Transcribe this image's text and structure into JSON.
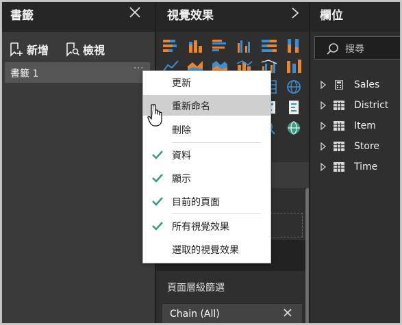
{
  "bookmarks_pane": {
    "title": "書籤",
    "add_label": "新增",
    "view_label": "檢視",
    "items": [
      {
        "label": "書籤 1",
        "more": "···"
      }
    ]
  },
  "visualizations_pane": {
    "title": "視覺效果",
    "page_filters_label": "頁面層級篩選",
    "filter_chip": {
      "label": "Chain (All)"
    }
  },
  "fields_pane": {
    "title": "欄位",
    "search_placeholder": "搜尋",
    "fields": [
      {
        "name": "Sales",
        "icon": "calculator-icon"
      },
      {
        "name": "District",
        "icon": "table-icon"
      },
      {
        "name": "Item",
        "icon": "table-icon"
      },
      {
        "name": "Store",
        "icon": "table-icon"
      },
      {
        "name": "Time",
        "icon": "table-icon"
      }
    ]
  },
  "context_menu": {
    "items": [
      {
        "label": "更新",
        "checked": false
      },
      {
        "label": "重新命名",
        "checked": false,
        "hovered": true
      },
      {
        "label": "刪除",
        "checked": false
      },
      {
        "label": "資料",
        "checked": true
      },
      {
        "label": "顯示",
        "checked": true
      },
      {
        "label": "目前的頁面",
        "checked": true
      },
      {
        "label": "所有視覺效果",
        "checked": true
      },
      {
        "label": "選取的視覺效果",
        "checked": false
      }
    ]
  },
  "colors": {
    "accent_orange": "#e8872f",
    "accent_blue": "#3a8fd4",
    "check_green": "#3a9c83"
  }
}
